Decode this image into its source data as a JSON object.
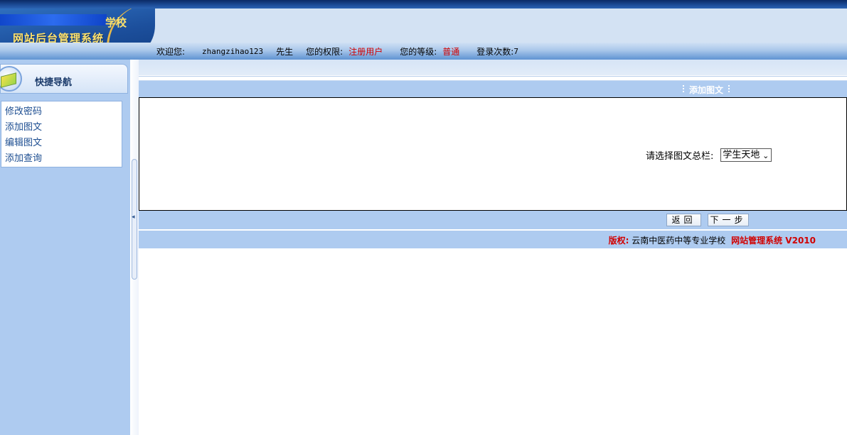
{
  "header": {
    "school_suffix": "学校",
    "system_title": "网站后台管理系统"
  },
  "welcome": {
    "greeting_label": "欢迎您:",
    "username": "zhangzihao123",
    "honorific": "先生",
    "permission_label": "您的权限:",
    "permission_value": "注册用户",
    "level_label": "您的等级:",
    "level_value": "普通",
    "login_count_label": "登录次数:",
    "login_count": "7"
  },
  "nav": {
    "title": "快捷导航",
    "items": [
      "修改密码",
      "添加图文",
      "编辑图文",
      "添加查询"
    ]
  },
  "main": {
    "section_title": "添加图文",
    "select_label": "请选择图文总栏:",
    "select_value": "学生天地",
    "back_button": "返回",
    "next_button": "下一步"
  },
  "footer": {
    "copyright_label": "版权:",
    "school_name": "云南中医药中等专业学校",
    "system_name": "网站管理系统 V2010"
  },
  "colors": {
    "accent_red": "#d10000",
    "bar_blue": "#aecbf0",
    "header_blue": "#1c4f9c",
    "logo_text": "#ffe26b"
  }
}
